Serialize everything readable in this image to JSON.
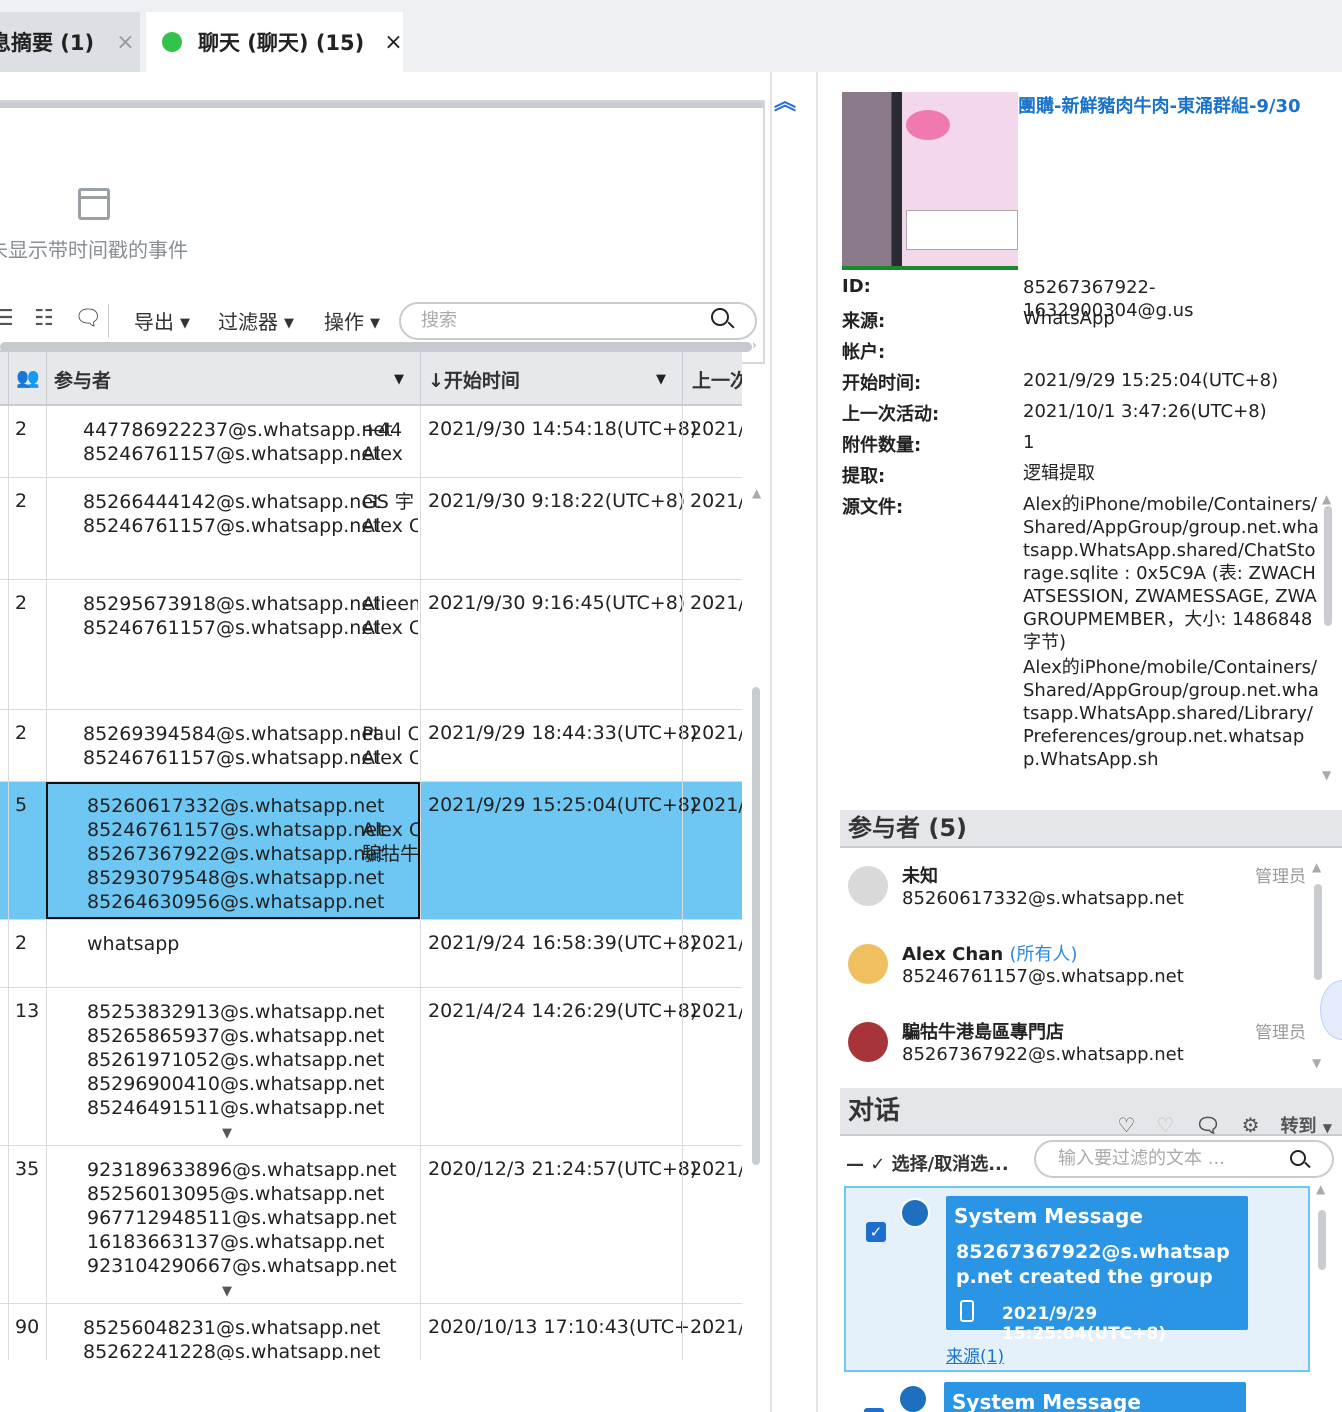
{
  "tabs": [
    {
      "label": "息摘要 (1)",
      "close": "×"
    },
    {
      "label": "聊天 (聊天) (15)",
      "close": "×"
    }
  ],
  "timeline": {
    "empty_text": "未显示带时间戳的事件"
  },
  "toolbar": {
    "export": "导出",
    "filter": "过滤器",
    "actions": "操作",
    "search_placeholder": "搜索"
  },
  "grid": {
    "columns": [
      "参与者",
      "开始时间",
      "上一次"
    ],
    "rows": [
      {
        "count": "2",
        "participants": [
          "447786922237@s.whatsapp.net",
          "85246761157@s.whatsapp.net"
        ],
        "names": [
          "+44",
          "Alex"
        ],
        "start": "2021/9/30 14:54:18(UTC+8)",
        "last": "2021/"
      },
      {
        "count": "2",
        "participants": [
          "85266444142@s.whatsapp.net",
          "85246761157@s.whatsapp.net"
        ],
        "names": [
          "GS 宇",
          "Alex C"
        ],
        "start": "2021/9/30 9:18:22(UTC+8)",
        "last": "2021/"
      },
      {
        "count": "2",
        "participants": [
          "85295673918@s.whatsapp.net",
          "85246761157@s.whatsapp.net"
        ],
        "names": [
          "Alieen",
          "Alex C"
        ],
        "start": "2021/9/30 9:16:45(UTC+8)",
        "last": "2021/"
      },
      {
        "count": "2",
        "participants": [
          "85269394584@s.whatsapp.net",
          "85246761157@s.whatsapp.net"
        ],
        "names": [
          "Paul C",
          "Alex C"
        ],
        "start": "2021/9/29 18:44:33(UTC+8)",
        "last": "2021/"
      },
      {
        "count": "5",
        "participants": [
          "85260617332@s.whatsapp.net",
          "85246761157@s.whatsapp.net",
          "85267367922@s.whatsapp.net",
          "85293079548@s.whatsapp.net",
          "85264630956@s.whatsapp.net"
        ],
        "names": [
          "",
          "Alex C",
          "騙牯牛",
          "",
          ""
        ],
        "start": "2021/9/29 15:25:04(UTC+8)",
        "last": "2021/",
        "selected": true
      },
      {
        "count": "2",
        "participants": [
          "whatsapp"
        ],
        "names": [],
        "start": "2021/9/24 16:58:39(UTC+8)",
        "last": "2021/"
      },
      {
        "count": "13",
        "participants": [
          "85253832913@s.whatsapp.net",
          "85265865937@s.whatsapp.net",
          "85261971052@s.whatsapp.net",
          "85296900410@s.whatsapp.net",
          "85246491511@s.whatsapp.net"
        ],
        "names": [],
        "start": "2021/4/24 14:26:29(UTC+8)",
        "last": "2021/"
      },
      {
        "count": "35",
        "participants": [
          "923189633896@s.whatsapp.net",
          "85256013095@s.whatsapp.net",
          "967712948511@s.whatsapp.net",
          "16183663137@s.whatsapp.net",
          "923104290667@s.whatsapp.net"
        ],
        "names": [],
        "start": "2020/12/3 21:24:57(UTC+8)",
        "last": "2021/"
      },
      {
        "count": "90",
        "participants": [
          "85256048231@s.whatsapp.net",
          "85262241228@s.whatsapp.net"
        ],
        "names": [],
        "start": "2020/10/13 17:10:43(UTC+...",
        "last": "2021/"
      }
    ]
  },
  "details": {
    "title": "團購-新鮮豬肉牛肉-東涌群組-9/30",
    "props": [
      {
        "label": "ID:",
        "value": "85267367922-1632900304@g.us"
      },
      {
        "label": "来源:",
        "value": "WhatsApp"
      },
      {
        "label": "帐户:",
        "value": ""
      },
      {
        "label": "开始时间:",
        "value": "2021/9/29 15:25:04(UTC+8)"
      },
      {
        "label": "上一次活动:",
        "value": "2021/10/1 3:47:26(UTC+8)"
      },
      {
        "label": "附件数量:",
        "value": "1"
      },
      {
        "label": "提取:",
        "value": "逻辑提取"
      },
      {
        "label": "源文件:",
        "value": "Alex的iPhone/mobile/Containers/Shared/AppGroup/group.net.whatsapp.WhatsApp.shared/ChatStorage.sqlite : 0x5C9A (表: ZWACHATSESSION, ZWAMESSAGE, ZWAGROUPMEMBER，大小: 1486848 字节)"
      },
      {
        "label": "",
        "value": "Alex的iPhone/mobile/Containers/Shared/AppGroup/group.net.whatsapp.WhatsApp.shared/Library/Preferences/group.net.whatsapp.WhatsApp.sh"
      }
    ]
  },
  "participants_section": {
    "title": "参与者 (5)",
    "members": [
      {
        "name": "未知",
        "owner": "",
        "number": "85260617332@s.whatsapp.net",
        "role": "管理员"
      },
      {
        "name": "Alex Chan",
        "owner": "(所有人)",
        "number": "85246761157@s.whatsapp.net",
        "role": ""
      },
      {
        "name": "騙牯牛港島區專門店",
        "owner": "",
        "number": "85267367922@s.whatsapp.net",
        "role": "管理员"
      }
    ]
  },
  "conversation": {
    "title": "对话",
    "goto": "转到",
    "select_label": "选择/取消选...",
    "filter_placeholder": "输入要过滤的文本 ...",
    "messages": [
      {
        "sender": "System Message",
        "body": "85267367922@s.whatsapp.net created the group",
        "time": "2021/9/29 15:25:04(UTC+8)",
        "source": "来源(1)"
      },
      {
        "sender": "System Message"
      }
    ]
  },
  "colors": {
    "accent": "#2a95e4",
    "selection": "#6ec6f3",
    "online": "#33c24a"
  }
}
